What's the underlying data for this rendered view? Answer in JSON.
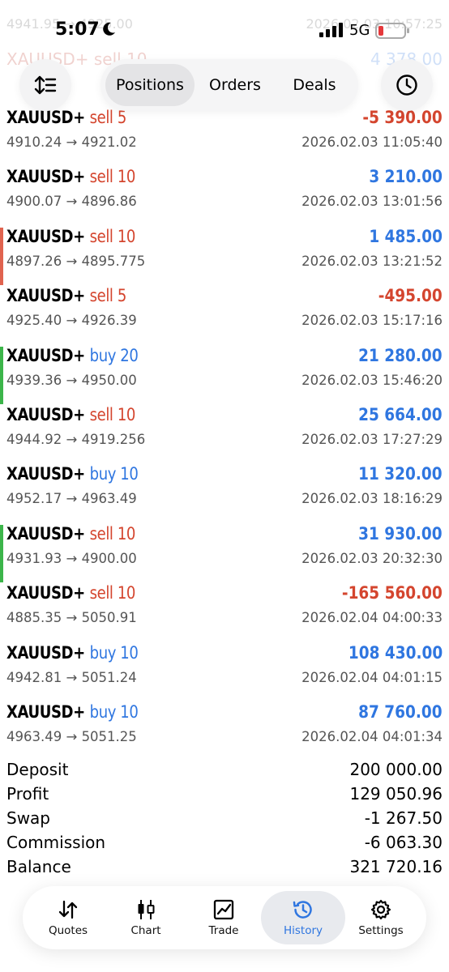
{
  "status": {
    "time": "5:07",
    "network": "5G"
  },
  "ghost_rows": [
    {
      "left": "4941.95 → 4925.00",
      "right": "2026.02.03 10:57:25"
    },
    {
      "left": "XAUUSD+ sell 10",
      "right": "4 378.00"
    }
  ],
  "header": {
    "tabs": [
      {
        "label": "Positions"
      },
      {
        "label": "Orders"
      },
      {
        "label": "Deals"
      }
    ],
    "active_tab": "Positions"
  },
  "trades": [
    {
      "symbol": "XAUUSD+",
      "side": "sell",
      "volume": "5",
      "open": "4910.24",
      "close": "4921.02",
      "profit": "-5 390.00",
      "time": "2026.02.03 11:05:40",
      "marker": ""
    },
    {
      "symbol": "XAUUSD+",
      "side": "sell",
      "volume": "10",
      "open": "4900.07",
      "close": "4896.86",
      "profit": "3 210.00",
      "time": "2026.02.03 13:01:56",
      "marker": ""
    },
    {
      "symbol": "XAUUSD+",
      "side": "sell",
      "volume": "10",
      "open": "4897.26",
      "close": "4895.775",
      "profit": "1 485.00",
      "time": "2026.02.03 13:21:52",
      "marker": "#e0634f"
    },
    {
      "symbol": "XAUUSD+",
      "side": "sell",
      "volume": "5",
      "open": "4925.40",
      "close": "4926.39",
      "profit": "-495.00",
      "time": "2026.02.03 15:17:16",
      "marker": ""
    },
    {
      "symbol": "XAUUSD+",
      "side": "buy",
      "volume": "20",
      "open": "4939.36",
      "close": "4950.00",
      "profit": "21 280.00",
      "time": "2026.02.03 15:46:20",
      "marker": "#3cb54a"
    },
    {
      "symbol": "XAUUSD+",
      "side": "sell",
      "volume": "10",
      "open": "4944.92",
      "close": "4919.256",
      "profit": "25 664.00",
      "time": "2026.02.03 17:27:29",
      "marker": ""
    },
    {
      "symbol": "XAUUSD+",
      "side": "buy",
      "volume": "10",
      "open": "4952.17",
      "close": "4963.49",
      "profit": "11 320.00",
      "time": "2026.02.03 18:16:29",
      "marker": ""
    },
    {
      "symbol": "XAUUSD+",
      "side": "sell",
      "volume": "10",
      "open": "4931.93",
      "close": "4900.00",
      "profit": "31 930.00",
      "time": "2026.02.03 20:32:30",
      "marker": "#3cb54a"
    },
    {
      "symbol": "XAUUSD+",
      "side": "sell",
      "volume": "10",
      "open": "4885.35",
      "close": "5050.91",
      "profit": "-165 560.00",
      "time": "2026.02.04 04:00:33",
      "marker": ""
    },
    {
      "symbol": "XAUUSD+",
      "side": "buy",
      "volume": "10",
      "open": "4942.81",
      "close": "5051.24",
      "profit": "108 430.00",
      "time": "2026.02.04 04:01:15",
      "marker": ""
    },
    {
      "symbol": "XAUUSD+",
      "side": "buy",
      "volume": "10",
      "open": "4963.49",
      "close": "5051.25",
      "profit": "87 760.00",
      "time": "2026.02.04 04:01:34",
      "marker": ""
    }
  ],
  "summary": {
    "deposit_label": "Deposit",
    "deposit": "200 000.00",
    "profit_label": "Profit",
    "profit": "129 050.96",
    "swap_label": "Swap",
    "swap": "-1 267.50",
    "commission_label": "Commission",
    "commission": "-6 063.30",
    "balance_label": "Balance",
    "balance": "321 720.16"
  },
  "nav": [
    {
      "label": "Quotes",
      "icon": "quotes-arrows-icon"
    },
    {
      "label": "Chart",
      "icon": "candlestick-chart-icon"
    },
    {
      "label": "Trade",
      "icon": "trade-chart-icon"
    },
    {
      "label": "History",
      "icon": "history-clock-icon",
      "active": true
    },
    {
      "label": "Settings",
      "icon": "gear-icon"
    }
  ],
  "colors": {
    "sell": "#d4452e",
    "buy": "#2f76e0",
    "loss": "#d4452e",
    "gain": "#2f76e0",
    "accent": "#2f76e0"
  }
}
